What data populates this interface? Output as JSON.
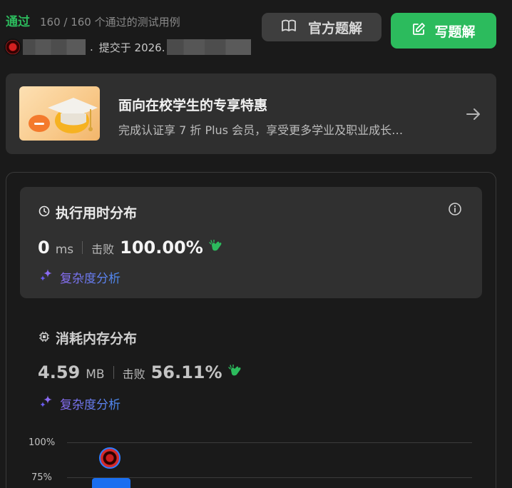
{
  "status": {
    "label": "通过",
    "cases": "160 / 160 个通过的测试用例"
  },
  "submission": {
    "dot": ".",
    "text": "提交于 2026."
  },
  "buttons": {
    "official_solution": "官方题解",
    "write_solution": "写题解"
  },
  "promo": {
    "title": "面向在校学生的专享特惠",
    "subtitle": "完成认证享 7 折 Plus 会员，享受更多学业及职业成长…"
  },
  "runtime": {
    "title": "执行用时分布",
    "value": "0",
    "unit": "ms",
    "beat_label": "击败",
    "percent": "100.00%",
    "complexity_link": "复杂度分析"
  },
  "memory": {
    "title": "消耗内存分布",
    "value": "4.59",
    "unit": "MB",
    "beat_label": "击败",
    "percent": "56.11%",
    "complexity_link": "复杂度分析"
  },
  "chart_data": {
    "type": "bar",
    "y_ticks": [
      "100%",
      "75%"
    ]
  },
  "colors": {
    "accent_green": "#2cbb5d",
    "link_purple": "#6e7ff3",
    "bar_blue": "#1a6ff0"
  }
}
